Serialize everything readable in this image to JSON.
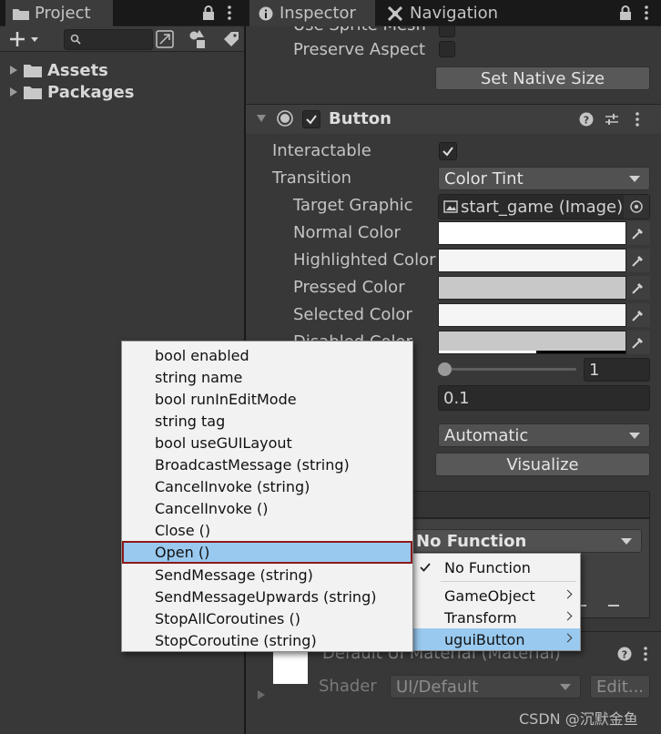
{
  "project": {
    "tab": "Project",
    "tree": [
      {
        "label": "Assets"
      },
      {
        "label": "Packages"
      }
    ]
  },
  "inspector": {
    "tabs": [
      "Inspector",
      "Navigation"
    ],
    "cut_label": "Use Sprite Mesh",
    "preserve_aspect": "Preserve Aspect",
    "set_native_size": "Set Native Size",
    "component_title": "Button",
    "interactable": "Interactable",
    "transition": "Transition",
    "transition_value": "Color Tint",
    "target_graphic": "Target Graphic",
    "target_graphic_value": "start_game (Image)",
    "normal_color": "Normal Color",
    "highlighted_color": "Highlighted Color",
    "pressed_color": "Pressed Color",
    "selected_color": "Selected Color",
    "disabled_color": "Disabled Color",
    "color_multiplier_value": "1",
    "fade_duration_value": "0.1",
    "navigation_value": "Automatic",
    "visualize": "Visualize",
    "event_function": "No Function",
    "material_name": "Default UI Material (Material)",
    "shader_label": "Shader",
    "shader_value": "UI/Default",
    "edit_button": "Edit..."
  },
  "colors": {
    "normal": "#ffffff",
    "highlighted": "#f5f5f5",
    "pressed": "#c8c8c8",
    "selected": "#f5f5f5",
    "disabled": "#c8c8c8"
  },
  "function_menu": {
    "items": [
      {
        "label": "No Function",
        "checked": true
      },
      {
        "label": "GameObject"
      },
      {
        "label": "Transform"
      },
      {
        "label": "uguiButton"
      }
    ]
  },
  "method_menu": {
    "items": [
      "bool enabled",
      "string name",
      "bool runInEditMode",
      "string tag",
      "bool useGUILayout",
      "BroadcastMessage (string)",
      "CancelInvoke (string)",
      "CancelInvoke ()",
      "Close ()",
      "Open ()",
      "SendMessage (string)",
      "SendMessageUpwards (string)",
      "StopAllCoroutines ()",
      "StopCoroutine (string)"
    ],
    "selected": "Open ()"
  },
  "watermark": "CSDN @沉默金鱼"
}
